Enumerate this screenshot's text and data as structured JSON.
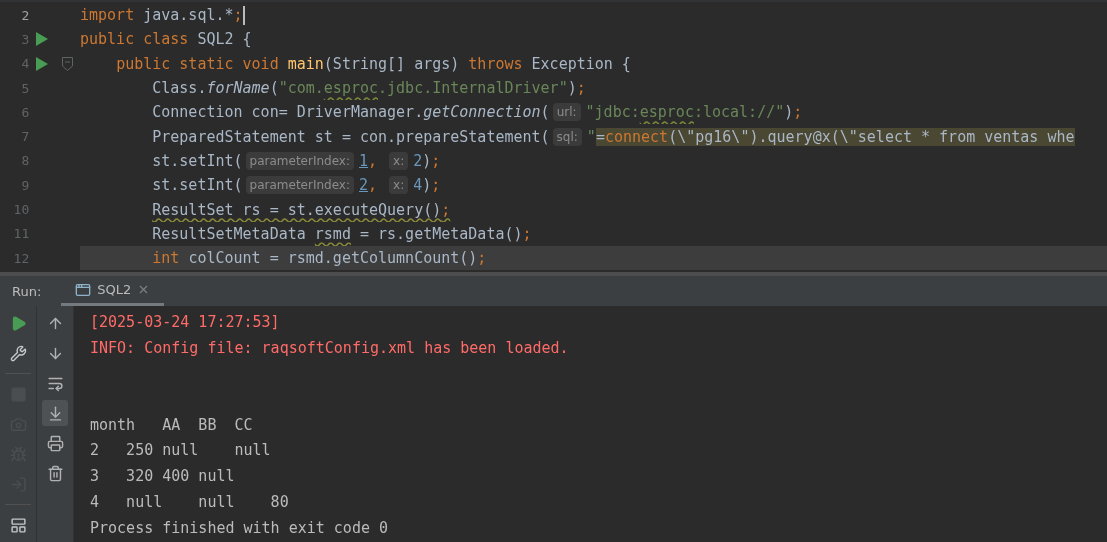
{
  "editor": {
    "lines": [
      {
        "number": "2",
        "run_marker": false,
        "fold_marker": false,
        "caret": true,
        "highlighted": false,
        "tokens": [
          {
            "text": "import",
            "kind": "keyword"
          },
          {
            "text": " java.sql.*",
            "kind": "plain"
          },
          {
            "text": ";",
            "kind": "punct"
          }
        ]
      },
      {
        "number": "3",
        "run_marker": true,
        "fold_marker": false,
        "caret": false,
        "highlighted": false,
        "tokens": [
          {
            "text": "public class",
            "kind": "keyword"
          },
          {
            "text": " SQL2 {",
            "kind": "plain"
          }
        ]
      },
      {
        "number": "4",
        "run_marker": true,
        "fold_marker": true,
        "caret": false,
        "highlighted": false,
        "tokens": [
          {
            "text": "    public static void ",
            "kind": "keyword"
          },
          {
            "text": "main",
            "kind": "declaration"
          },
          {
            "text": "(String[] args) ",
            "kind": "plain"
          },
          {
            "text": "throws",
            "kind": "keyword"
          },
          {
            "text": " Exception {",
            "kind": "plain"
          }
        ]
      },
      {
        "number": "5",
        "run_marker": false,
        "fold_marker": false,
        "caret": false,
        "highlighted": false,
        "tokens": [
          {
            "text": "        Class.",
            "kind": "plain"
          },
          {
            "text": "forName",
            "kind": "italic"
          },
          {
            "text": "(",
            "kind": "plain"
          },
          {
            "text": "\"com.",
            "kind": "string"
          },
          {
            "text": "esproc",
            "kind": "string-typo"
          },
          {
            "text": ".jdbc.InternalDriver\"",
            "kind": "string"
          },
          {
            "text": ")",
            "kind": "plain"
          },
          {
            "text": ";",
            "kind": "punct"
          }
        ]
      },
      {
        "number": "6",
        "run_marker": false,
        "fold_marker": false,
        "caret": false,
        "highlighted": false,
        "tokens": [
          {
            "text": "        Connection con= DriverManager.",
            "kind": "plain"
          },
          {
            "text": "getConnection",
            "kind": "italic"
          },
          {
            "text": "(",
            "kind": "plain"
          },
          {
            "text": "url:",
            "kind": "hint"
          },
          {
            "text": "\"jdbc:",
            "kind": "string"
          },
          {
            "text": "esproc",
            "kind": "string-typo"
          },
          {
            "text": ":local://\"",
            "kind": "string"
          },
          {
            "text": ")",
            "kind": "plain"
          },
          {
            "text": ";",
            "kind": "punct"
          }
        ]
      },
      {
        "number": "7",
        "run_marker": false,
        "fold_marker": false,
        "caret": false,
        "highlighted": false,
        "tokens": [
          {
            "text": "        PreparedStatement st = con.prepareStatement(",
            "kind": "plain"
          },
          {
            "text": "sql:",
            "kind": "hint"
          },
          {
            "text": "\"",
            "kind": "string"
          },
          {
            "text": "=",
            "kind": "injected"
          },
          {
            "text": "connect",
            "kind": "injected-keyword"
          },
          {
            "text": "(\\\"pg16\\\").query@x(\\\"select * from ventas whe",
            "kind": "injected"
          }
        ]
      },
      {
        "number": "8",
        "run_marker": false,
        "fold_marker": false,
        "caret": false,
        "highlighted": false,
        "tokens": [
          {
            "text": "        st.setInt(",
            "kind": "plain"
          },
          {
            "text": "parameterIndex:",
            "kind": "hint"
          },
          {
            "text": "1",
            "kind": "number-link"
          },
          {
            "text": ", ",
            "kind": "punct"
          },
          {
            "text": "x:",
            "kind": "hint"
          },
          {
            "text": "2",
            "kind": "number"
          },
          {
            "text": ")",
            "kind": "plain"
          },
          {
            "text": ";",
            "kind": "punct"
          }
        ]
      },
      {
        "number": "9",
        "run_marker": false,
        "fold_marker": false,
        "caret": false,
        "highlighted": false,
        "tokens": [
          {
            "text": "        st.setInt(",
            "kind": "plain"
          },
          {
            "text": "parameterIndex:",
            "kind": "hint"
          },
          {
            "text": "2",
            "kind": "number-link"
          },
          {
            "text": ", ",
            "kind": "punct"
          },
          {
            "text": "x:",
            "kind": "hint"
          },
          {
            "text": "4",
            "kind": "number"
          },
          {
            "text": ")",
            "kind": "plain"
          },
          {
            "text": ";",
            "kind": "punct"
          }
        ]
      },
      {
        "number": "10",
        "run_marker": false,
        "fold_marker": false,
        "caret": false,
        "highlighted": false,
        "tokens": [
          {
            "text": "        ResultSet rs = st.executeQuery()",
            "kind": "typo"
          },
          {
            "text": ";",
            "kind": "punct-typo"
          }
        ]
      },
      {
        "number": "11",
        "run_marker": false,
        "fold_marker": false,
        "caret": false,
        "highlighted": false,
        "tokens": [
          {
            "text": "        ResultSetMetaData ",
            "kind": "plain"
          },
          {
            "text": "rsmd",
            "kind": "typo"
          },
          {
            "text": " = rs.getMetaData()",
            "kind": "plain"
          },
          {
            "text": ";",
            "kind": "punct"
          }
        ]
      },
      {
        "number": "12",
        "run_marker": false,
        "fold_marker": false,
        "caret": false,
        "highlighted": true,
        "tokens": [
          {
            "text": "        int",
            "kind": "keyword"
          },
          {
            "text": " colCount = rsmd.getColumnCount()",
            "kind": "plain"
          },
          {
            "text": ";",
            "kind": "punct"
          }
        ]
      }
    ]
  },
  "run_panel": {
    "label": "Run:",
    "tabs": [
      {
        "label": "SQL2",
        "selected": true
      }
    ],
    "toolbar_main": [
      {
        "kind": "run",
        "disabled": false
      },
      {
        "kind": "settings",
        "disabled": false
      },
      {
        "kind": "separator"
      },
      {
        "kind": "stop",
        "disabled": true
      },
      {
        "kind": "camera",
        "disabled": true
      },
      {
        "kind": "debug",
        "disabled": true
      },
      {
        "kind": "attach",
        "disabled": true
      },
      {
        "kind": "separator"
      },
      {
        "kind": "layout",
        "disabled": false
      }
    ],
    "toolbar_side": [
      {
        "kind": "up",
        "selected": false
      },
      {
        "kind": "down",
        "selected": false
      },
      {
        "kind": "wrap",
        "selected": false
      },
      {
        "kind": "scroll-end",
        "selected": true
      },
      {
        "kind": "print",
        "selected": false
      },
      {
        "kind": "trash",
        "selected": false
      }
    ],
    "console": [
      {
        "kind": "error",
        "text": "[2025-03-24 17:27:53]"
      },
      {
        "kind": "error",
        "text": "INFO: Config file: raqsoftConfig.xml has been loaded."
      },
      {
        "kind": "spacer"
      },
      {
        "kind": "spacer"
      },
      {
        "kind": "output",
        "text": "month   AA  BB  CC"
      },
      {
        "kind": "output",
        "text": "2   250 null    null"
      },
      {
        "kind": "output",
        "text": "3   320 400 null"
      },
      {
        "kind": "output",
        "text": "4   null    null    80"
      },
      {
        "kind": "output",
        "text": "Process finished with exit code 0"
      }
    ]
  }
}
